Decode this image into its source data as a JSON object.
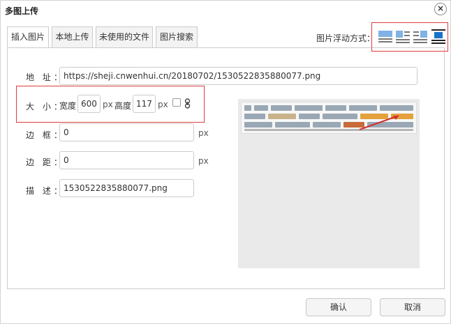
{
  "dialog": {
    "title": "多图上传",
    "close_label": "×"
  },
  "tabs": [
    {
      "label": "插入图片",
      "active": true
    },
    {
      "label": "本地上传",
      "active": false
    },
    {
      "label": "未使用的文件",
      "active": false
    },
    {
      "label": "图片搜索",
      "active": false
    }
  ],
  "float": {
    "label": "图片浮动方式：",
    "options": [
      "none",
      "left",
      "right",
      "center"
    ],
    "selected": "center"
  },
  "form": {
    "address": {
      "label": "地 址：",
      "value": "https://sheji.cnwenhui.cn/20180702/1530522835880077.png"
    },
    "size": {
      "label": "大 小：",
      "width_label": "宽度",
      "width_value": "600",
      "width_unit": "px",
      "height_label": "高度",
      "height_value": "117",
      "height_unit": "px",
      "lock_icon": "lock-icon"
    },
    "border": {
      "label": "边 框：",
      "value": "0",
      "unit": "px"
    },
    "margin": {
      "label": "边 距：",
      "value": "0",
      "unit": "px"
    },
    "desc": {
      "label": "描 述：",
      "value": "1530522835880077.png"
    }
  },
  "buttons": {
    "confirm": "确认",
    "cancel": "取消"
  },
  "colors": {
    "highlight": "#e03b3b",
    "selected_float": "#1a73c9",
    "float_icon": "#7fb2e5"
  }
}
